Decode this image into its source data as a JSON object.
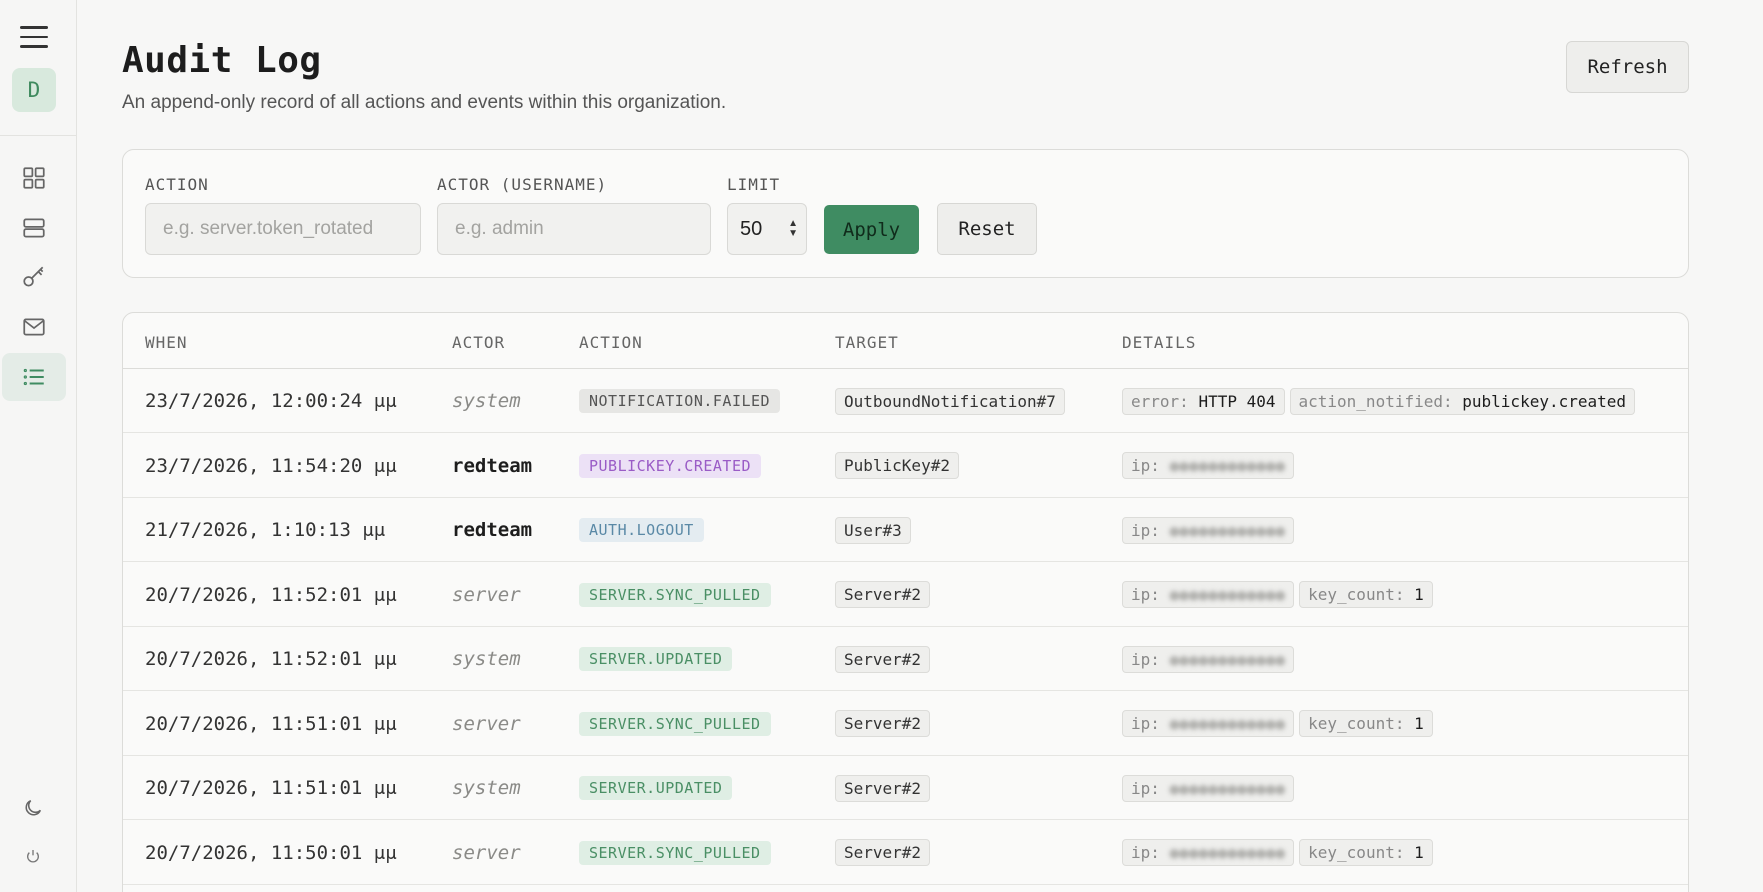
{
  "colors": {
    "accent_green": "#3f8c62",
    "badge_gray_bg": "#e6e6e4",
    "badge_gray_fg": "#555555",
    "badge_purple_bg": "#ece1f6",
    "badge_purple_fg": "#9a5cc6",
    "badge_blue_bg": "#e4ecf1",
    "badge_blue_fg": "#5a89a6",
    "badge_green_bg": "#dfeee4",
    "badge_green_fg": "#4a8f65"
  },
  "sidebar": {
    "avatar_initial": "D",
    "nav": [
      {
        "icon": "grid-icon",
        "active": false
      },
      {
        "icon": "server-icon",
        "active": false
      },
      {
        "icon": "key-icon",
        "active": false
      },
      {
        "icon": "mail-icon",
        "active": false
      },
      {
        "icon": "list-icon",
        "active": true
      }
    ],
    "bottom": [
      {
        "icon": "moon-icon"
      },
      {
        "icon": "power-icon"
      }
    ]
  },
  "header": {
    "title": "Audit Log",
    "subtitle": "An append-only record of all actions and events within this organization.",
    "refresh_label": "Refresh"
  },
  "filters": {
    "action_label": "ACTION",
    "action_placeholder": "e.g. server.token_rotated",
    "actor_label": "ACTOR (USERNAME)",
    "actor_placeholder": "e.g. admin",
    "limit_label": "LIMIT",
    "limit_value": "50",
    "apply_label": "Apply",
    "reset_label": "Reset"
  },
  "table": {
    "columns": [
      "WHEN",
      "ACTOR",
      "ACTION",
      "TARGET",
      "DETAILS"
    ],
    "rows": [
      {
        "when": "23/7/2026, 12:00:24 μμ",
        "actor": "system",
        "actor_style": "italic",
        "action": "NOTIFICATION.FAILED",
        "action_color": "gray",
        "target": "OutboundNotification#7",
        "details": [
          {
            "k": "error:",
            "v": "HTTP 404",
            "blur": false
          },
          {
            "k": "action_notified:",
            "v": "publickey.created",
            "blur": false
          }
        ]
      },
      {
        "when": "23/7/2026, 11:54:20 μμ",
        "actor": "redteam",
        "actor_style": "bold",
        "action": "PUBLICKEY.CREATED",
        "action_color": "purple",
        "target": "PublicKey#2",
        "details": [
          {
            "k": "ip:",
            "v": "●●●●●●●●●●●●",
            "blur": true
          }
        ]
      },
      {
        "when": "21/7/2026, 1:10:13 μμ",
        "actor": "redteam",
        "actor_style": "bold",
        "action": "AUTH.LOGOUT",
        "action_color": "blue",
        "target": "User#3",
        "details": [
          {
            "k": "ip:",
            "v": "●●●●●●●●●●●●",
            "blur": true
          }
        ]
      },
      {
        "when": "20/7/2026, 11:52:01 μμ",
        "actor": "server",
        "actor_style": "italic",
        "action": "SERVER.SYNC_PULLED",
        "action_color": "green",
        "target": "Server#2",
        "details": [
          {
            "k": "ip:",
            "v": "●●●●●●●●●●●●",
            "blur": true
          },
          {
            "k": "key_count:",
            "v": "1",
            "blur": false
          }
        ]
      },
      {
        "when": "20/7/2026, 11:52:01 μμ",
        "actor": "system",
        "actor_style": "italic",
        "action": "SERVER.UPDATED",
        "action_color": "green",
        "target": "Server#2",
        "details": [
          {
            "k": "ip:",
            "v": "●●●●●●●●●●●●",
            "blur": true
          }
        ]
      },
      {
        "when": "20/7/2026, 11:51:01 μμ",
        "actor": "server",
        "actor_style": "italic",
        "action": "SERVER.SYNC_PULLED",
        "action_color": "green",
        "target": "Server#2",
        "details": [
          {
            "k": "ip:",
            "v": "●●●●●●●●●●●●",
            "blur": true
          },
          {
            "k": "key_count:",
            "v": "1",
            "blur": false
          }
        ]
      },
      {
        "when": "20/7/2026, 11:51:01 μμ",
        "actor": "system",
        "actor_style": "italic",
        "action": "SERVER.UPDATED",
        "action_color": "green",
        "target": "Server#2",
        "details": [
          {
            "k": "ip:",
            "v": "●●●●●●●●●●●●",
            "blur": true
          }
        ]
      },
      {
        "when": "20/7/2026, 11:50:01 μμ",
        "actor": "server",
        "actor_style": "italic",
        "action": "SERVER.SYNC_PULLED",
        "action_color": "green",
        "target": "Server#2",
        "details": [
          {
            "k": "ip:",
            "v": "●●●●●●●●●●●●",
            "blur": true
          },
          {
            "k": "key_count:",
            "v": "1",
            "blur": false
          }
        ]
      }
    ]
  }
}
